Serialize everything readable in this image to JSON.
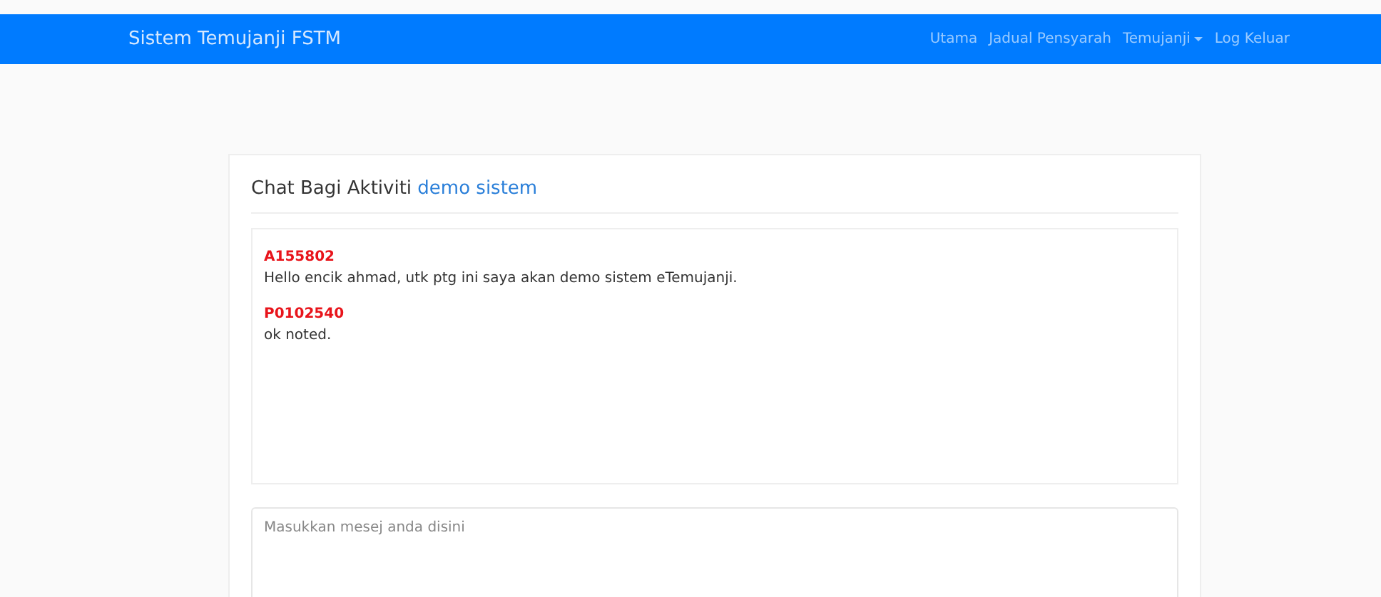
{
  "navbar": {
    "brand": "Sistem Temujanji FSTM",
    "links": [
      {
        "label": "Utama",
        "kind": "link"
      },
      {
        "label": "Jadual Pensyarah",
        "kind": "link"
      },
      {
        "label": "Temujanji",
        "kind": "dropdown"
      },
      {
        "label": "Log Keluar",
        "kind": "link"
      }
    ]
  },
  "chat": {
    "title": "Chat Bagi Aktiviti",
    "activity": "demo sistem",
    "messages": [
      {
        "sender": "A155802",
        "text": "Hello encik ahmad, utk ptg ini saya akan demo sistem eTemujanji."
      },
      {
        "sender": "P0102540",
        "text": "ok noted."
      }
    ],
    "input": {
      "placeholder": "Masukkan mesej anda disini"
    }
  }
}
